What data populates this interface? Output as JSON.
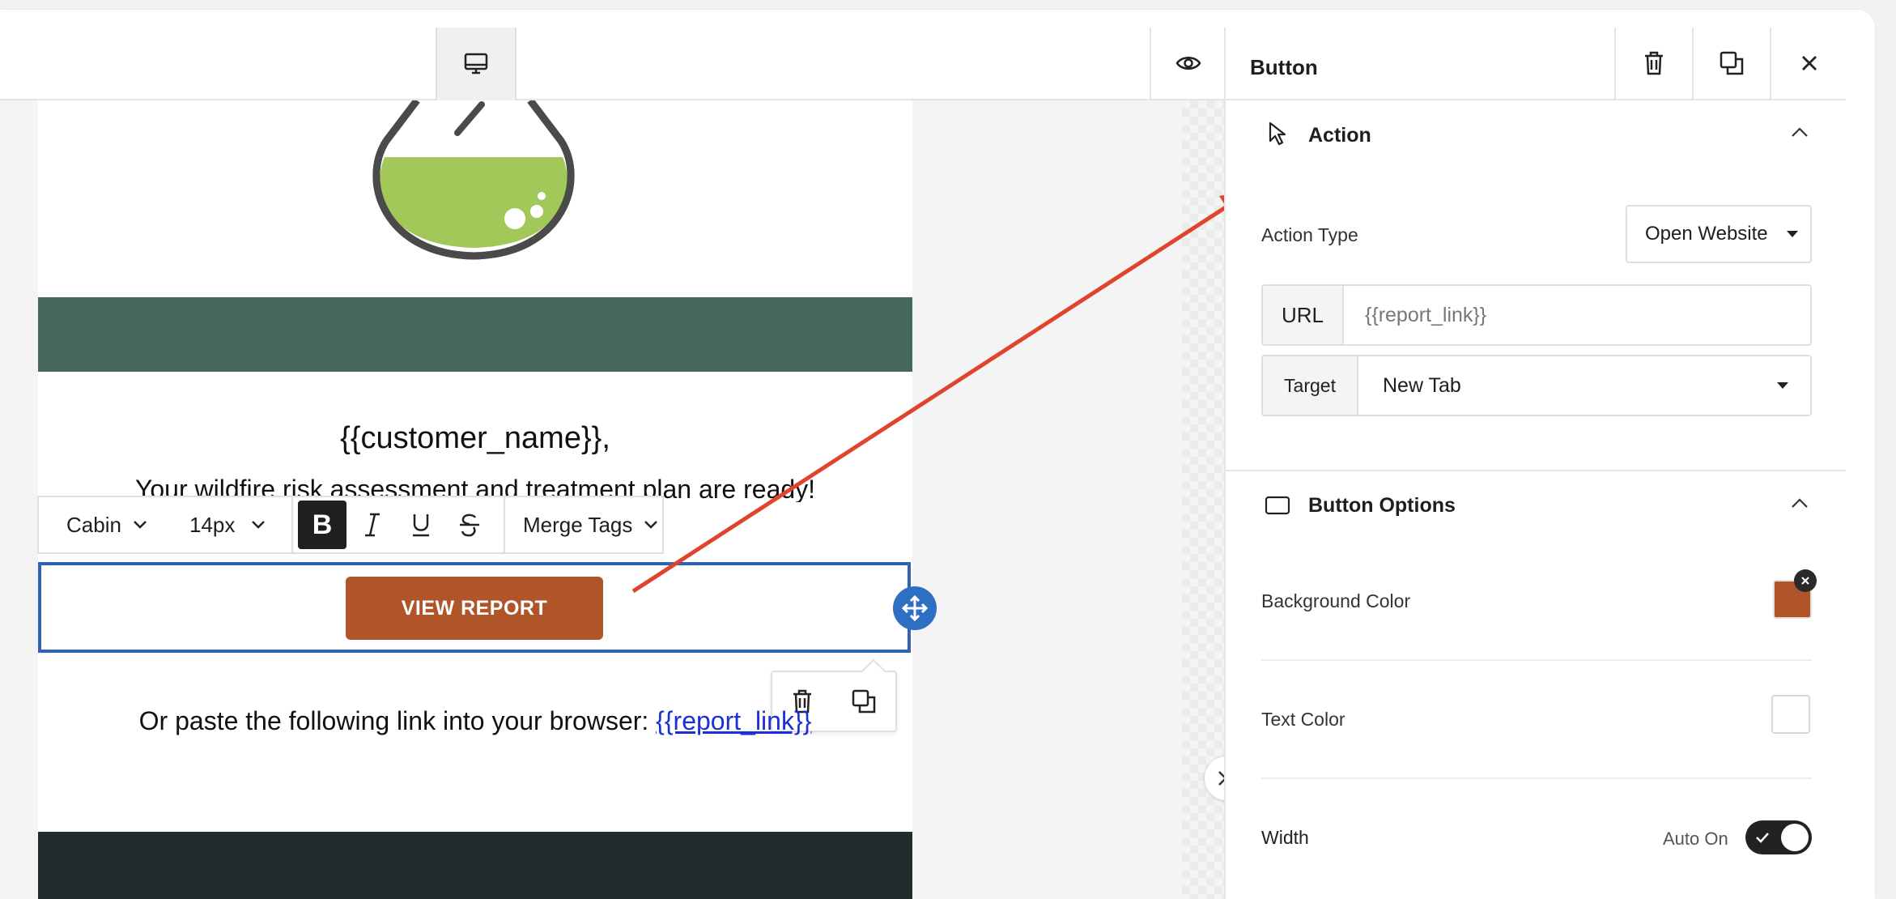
{
  "editor": {
    "device_icon": "desktop-icon",
    "preview_icon": "eye-icon"
  },
  "email": {
    "customer_placeholder": "{{customer_name}},",
    "subline": "Your wildfire risk assessment and treatment plan are ready!",
    "button_label": "VIEW REPORT",
    "paste_text": "Or paste the following link into your browser: ",
    "paste_link": "{{report_link}}",
    "colors": {
      "band_green": "#44695a",
      "band_dark": "#232c2c",
      "button": "#b0542a",
      "selection": "#2e64b1"
    }
  },
  "text_toolbar": {
    "font": "Cabin",
    "size": "14px",
    "merge_tags": "Merge Tags"
  },
  "panel": {
    "title": "Button",
    "action_section": {
      "title": "Action",
      "action_type_label": "Action Type",
      "action_type_value": "Open Website",
      "url_label": "URL",
      "url_placeholder": "{{report_link}}",
      "target_label": "Target",
      "target_value": "New Tab"
    },
    "options_section": {
      "title": "Button Options",
      "background_color_label": "Background Color",
      "background_color_value": "#b0542a",
      "text_color_label": "Text Color",
      "text_color_value": "#ffffff",
      "width_label": "Width",
      "width_toggle_label": "Auto On"
    }
  }
}
